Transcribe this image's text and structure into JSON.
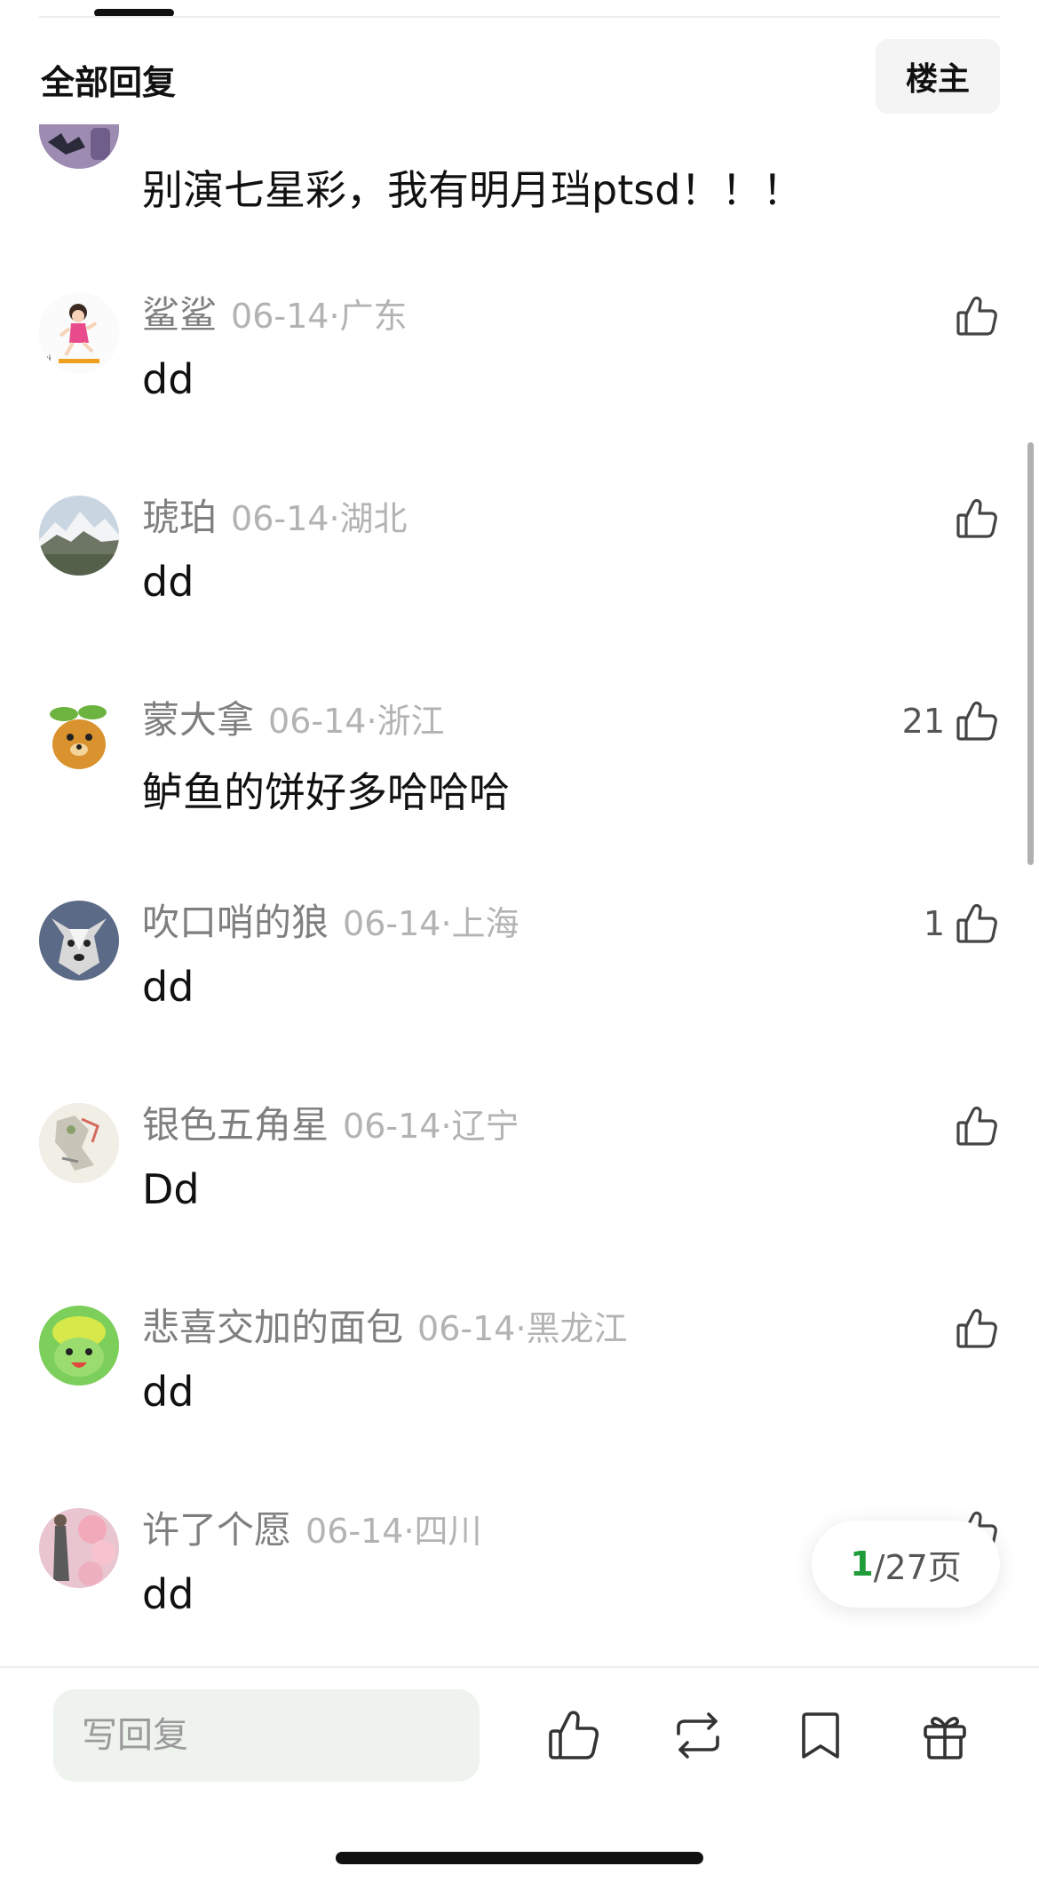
{
  "header": {
    "title": "全部回复",
    "op_button_label": "楼主"
  },
  "partial_comment": {
    "text": "别演七星彩，我有明月珰ptsd！！！"
  },
  "comments": [
    {
      "nickname": "鲨鲨",
      "date": "06-14",
      "location": "广东",
      "text": "dd",
      "likes": "",
      "avatar": "girl-running"
    },
    {
      "nickname": "琥珀",
      "date": "06-14",
      "location": "湖北",
      "text": "dd",
      "likes": "",
      "avatar": "snowy-mountain"
    },
    {
      "nickname": "蒙大拿",
      "date": "06-14",
      "location": "浙江",
      "text": "鲈鱼的饼好多哈哈哈",
      "likes": "21",
      "avatar": "cartoon-bear"
    },
    {
      "nickname": "吹口哨的狼",
      "date": "06-14",
      "location": "上海",
      "text": "dd",
      "likes": "1",
      "avatar": "husky-dog"
    },
    {
      "nickname": "银色五角星",
      "date": "06-14",
      "location": "辽宁",
      "text": "Dd",
      "likes": "",
      "avatar": "sketch-figure"
    },
    {
      "nickname": "悲喜交加的面包",
      "date": "06-14",
      "location": "黑龙江",
      "text": "dd",
      "likes": "",
      "avatar": "green-plush"
    },
    {
      "nickname": "许了个愿",
      "date": "06-14",
      "location": "四川",
      "text": "dd",
      "likes": "",
      "avatar": "cherry-blossom"
    }
  ],
  "pagination": {
    "current": "1",
    "total_text": "/27页"
  },
  "bottom_bar": {
    "reply_placeholder": "写回复",
    "icons": [
      "thumbs-up-icon",
      "repost-icon",
      "bookmark-icon",
      "gift-icon"
    ]
  },
  "colors": {
    "accent_green": "#1f9d3a",
    "nickname_gray": "#7f7f7f",
    "meta_gray": "#b3b3b3",
    "input_bg": "#eef3ee"
  }
}
